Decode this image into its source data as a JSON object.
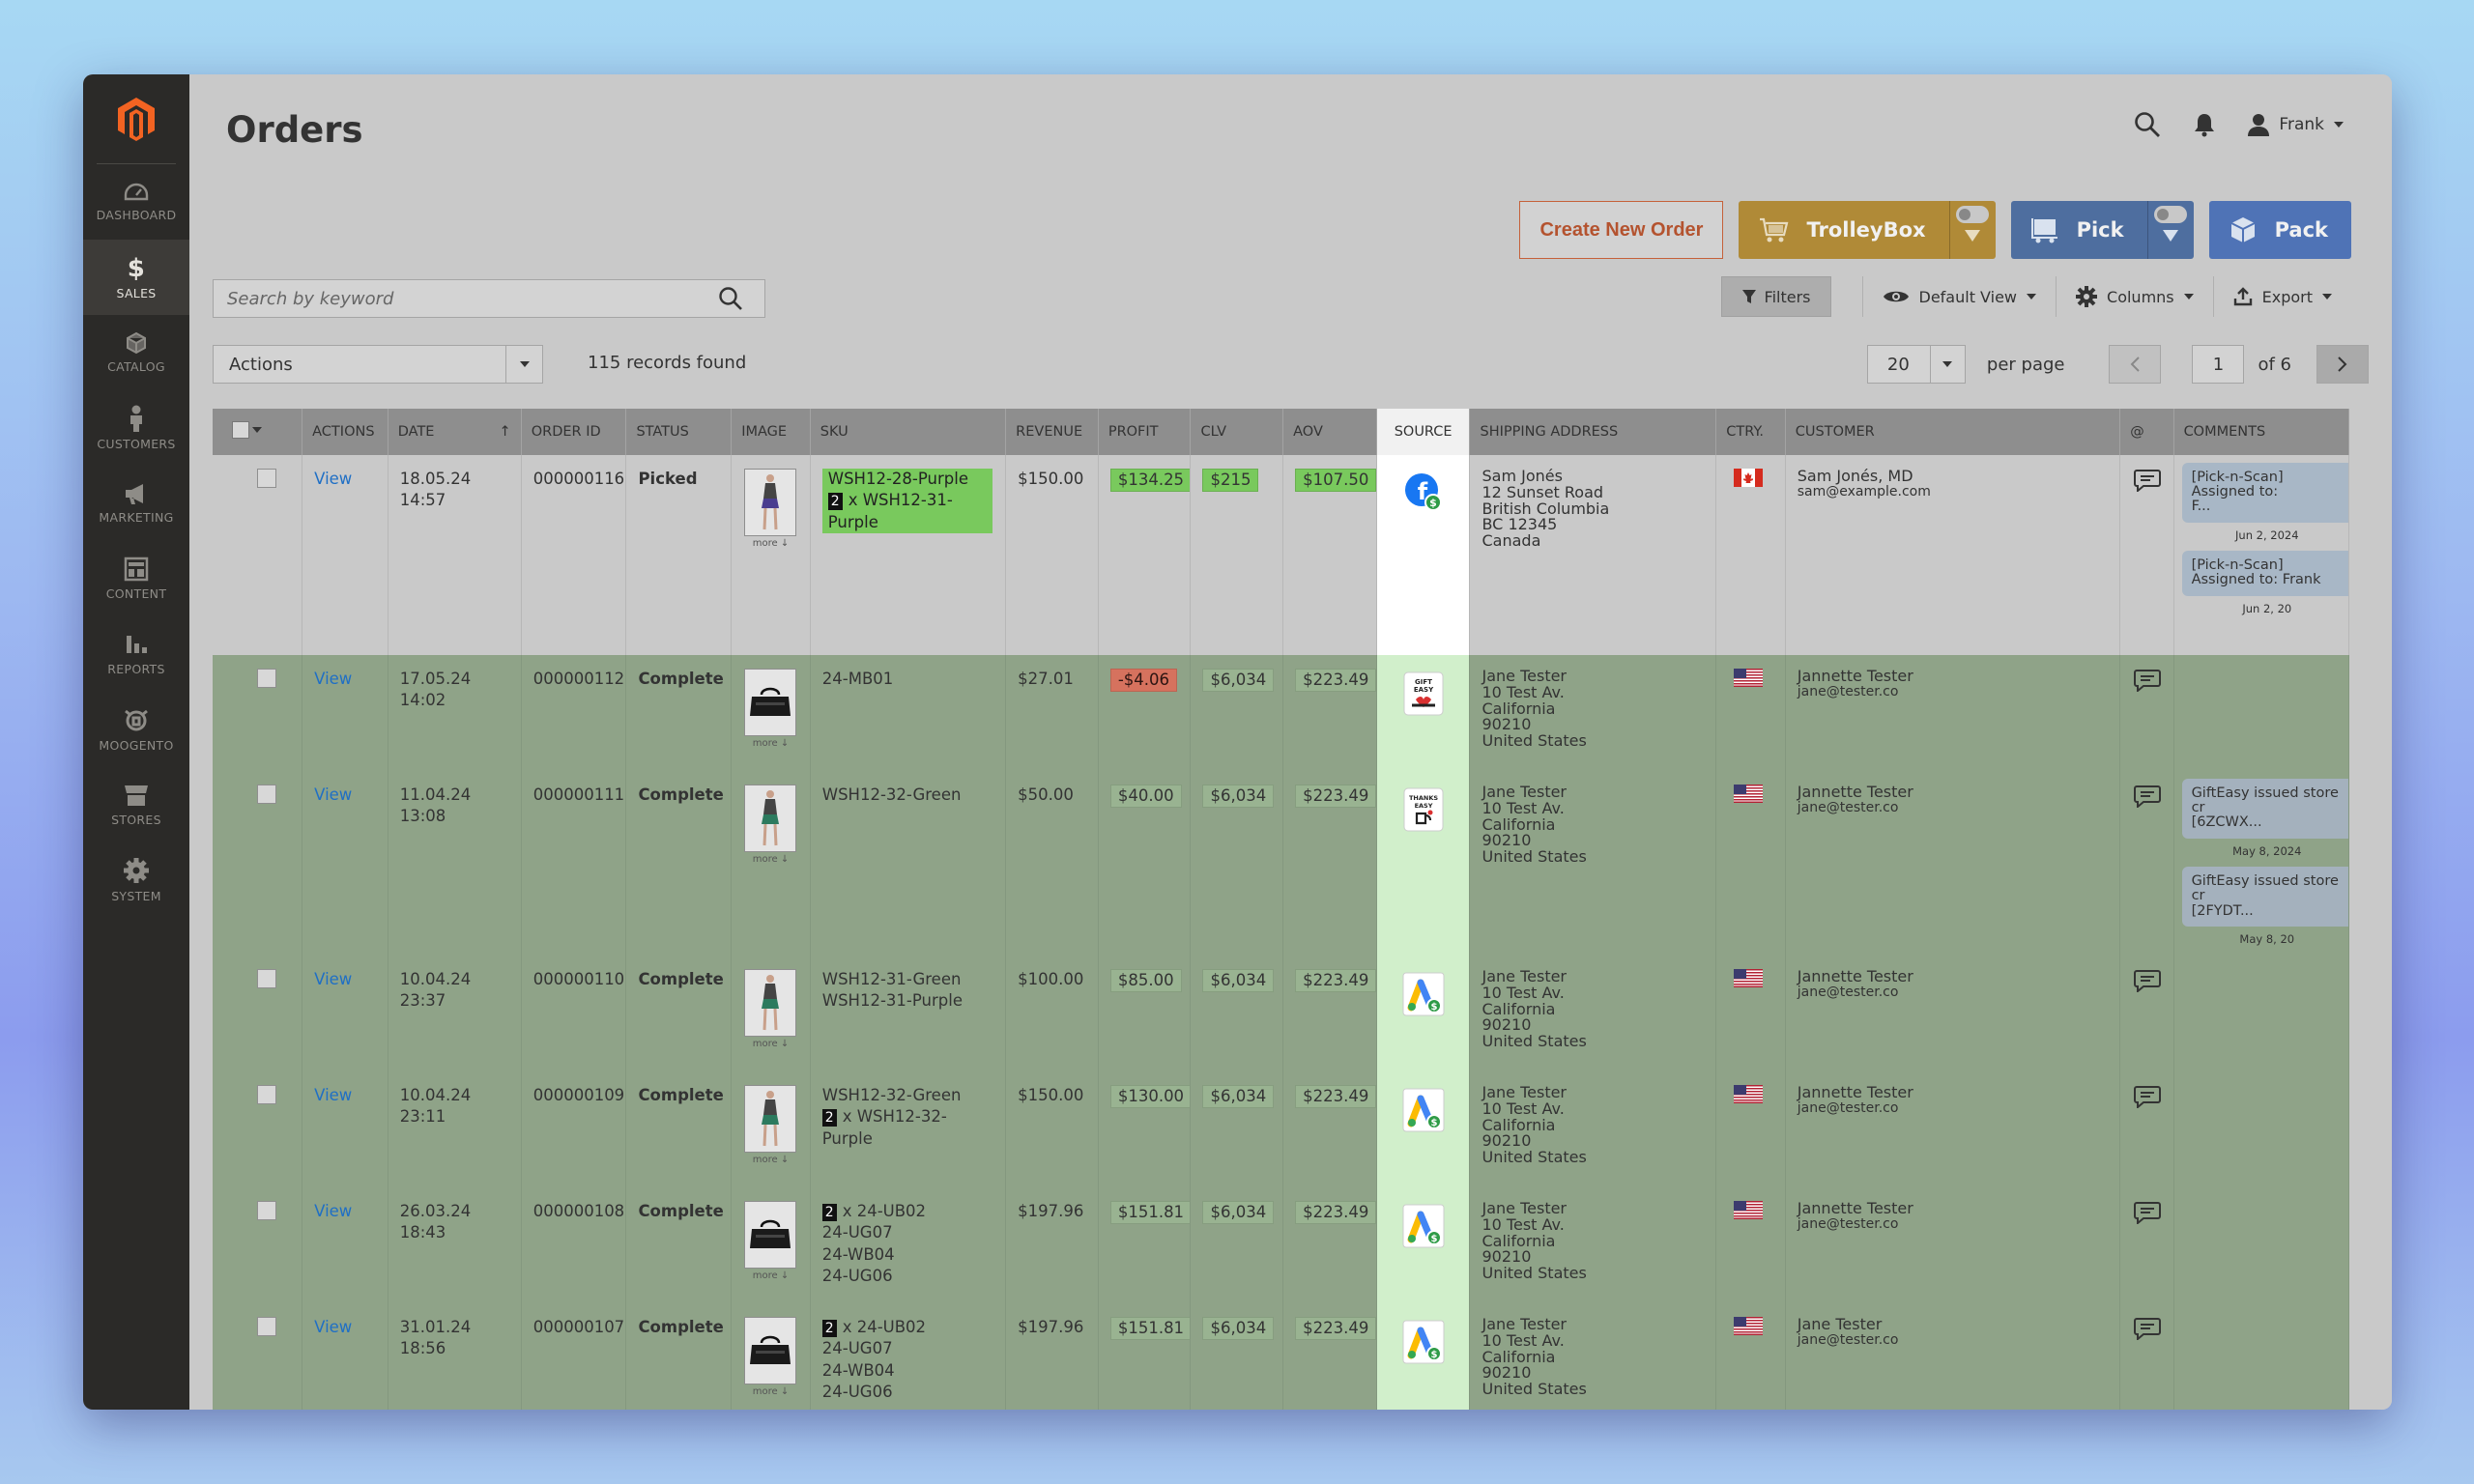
{
  "sidebar": {
    "items": [
      {
        "label": "DASHBOARD",
        "icon": "dashboard-icon"
      },
      {
        "label": "SALES",
        "icon": "dollar-icon"
      },
      {
        "label": "CATALOG",
        "icon": "cube-icon"
      },
      {
        "label": "CUSTOMERS",
        "icon": "person-icon"
      },
      {
        "label": "MARKETING",
        "icon": "megaphone-icon"
      },
      {
        "label": "CONTENT",
        "icon": "layout-icon"
      },
      {
        "label": "REPORTS",
        "icon": "bar-chart-icon"
      },
      {
        "label": "MOOGENTO",
        "icon": "moogento-icon"
      },
      {
        "label": "STORES",
        "icon": "store-icon"
      },
      {
        "label": "SYSTEM",
        "icon": "gear-icon"
      }
    ]
  },
  "header": {
    "title": "Orders",
    "user": "Frank",
    "create_order": "Create New Order",
    "trolleybox": "TrolleyBox",
    "pick": "Pick",
    "pack": "Pack"
  },
  "search": {
    "placeholder": "Search by keyword"
  },
  "toolbar": {
    "filters": "Filters",
    "view": "Default View",
    "columns": "Columns",
    "export": "Export",
    "actions": "Actions",
    "records": "115 records found",
    "per_page_value": "20",
    "per_page_label": "per page",
    "page": "1",
    "of_pages": "of 6"
  },
  "columns": [
    "ACTIONS",
    "DATE",
    "ORDER ID",
    "STATUS",
    "IMAGE",
    "SKU",
    "REVENUE",
    "PROFIT",
    "CLV",
    "AOV",
    "SOURCE",
    "SHIPPING ADDRESS",
    "CTRY.",
    "CUSTOMER",
    "@",
    "COMMENTS"
  ],
  "sort_indicator": "↑",
  "more_label": "more ↓",
  "rows": [
    {
      "action": "View",
      "date": "18.05.24 14:57",
      "order_id": "000000116",
      "status": "Picked",
      "sku1": "WSH12-28-Purple",
      "sku2_qty": "2",
      "sku2": "x WSH12-31-Purple",
      "revenue": "$150.00",
      "profit": "$134.25",
      "clv": "$215",
      "aov": "$107.50",
      "source": "facebook-icon",
      "addr": [
        "Sam Jonés",
        "12 Sunset Road",
        "British Columbia",
        "BC 12345",
        "Canada"
      ],
      "country": "CA",
      "customer": "Sam Jonés, MD",
      "email": "sam@example.com",
      "comments": [
        {
          "text": "[Pick-n-Scan]\nAssigned to:\nF...",
          "date": "Jun 2, 2024"
        },
        {
          "text": "[Pick-n-Scan]\nAssigned to: Frank",
          "date": "Jun 2, 20"
        }
      ]
    },
    {
      "action": "View",
      "date": "17.05.24 14:02",
      "order_id": "000000112",
      "status": "Complete",
      "sku1": "24-MB01",
      "revenue": "$27.01",
      "profit": "-$4.06",
      "clv": "$6,034",
      "aov": "$223.49",
      "source": "gift-easy-icon",
      "addr": [
        "Jane Tester",
        "10 Test Av.",
        "California",
        "90210",
        "United States"
      ],
      "country": "US",
      "customer": "Jannette Tester",
      "email": "jane@tester.co",
      "comments": []
    },
    {
      "action": "View",
      "date": "11.04.24 13:08",
      "order_id": "000000111",
      "status": "Complete",
      "sku1": "WSH12-32-Green",
      "revenue": "$50.00",
      "profit": "$40.00",
      "clv": "$6,034",
      "aov": "$223.49",
      "source": "thanks-easy-icon",
      "addr": [
        "Jane Tester",
        "10 Test Av.",
        "California",
        "90210",
        "United States"
      ],
      "country": "US",
      "customer": "Jannette Tester",
      "email": "jane@tester.co",
      "comments": [
        {
          "text": "GiftEasy issued store cr\n[6ZCWX...",
          "date": "May 8, 2024"
        },
        {
          "text": "GiftEasy issued store cr\n[2FYDT...",
          "date": "May 8, 20"
        }
      ]
    },
    {
      "action": "View",
      "date": "10.04.24 23:37",
      "order_id": "000000110",
      "status": "Complete",
      "sku1": "WSH12-31-Green",
      "sku2": "WSH12-31-Purple",
      "revenue": "$100.00",
      "profit": "$85.00",
      "clv": "$6,034",
      "aov": "$223.49",
      "source": "google-ads-icon",
      "addr": [
        "Jane Tester",
        "10 Test Av.",
        "California",
        "90210",
        "United States"
      ],
      "country": "US",
      "customer": "Jannette Tester",
      "email": "jane@tester.co",
      "comments": []
    },
    {
      "action": "View",
      "date": "10.04.24 23:11",
      "order_id": "000000109",
      "status": "Complete",
      "sku1": "WSH12-32-Green",
      "sku2_qty": "2",
      "sku2": "x WSH12-32-Purple",
      "revenue": "$150.00",
      "profit": "$130.00",
      "clv": "$6,034",
      "aov": "$223.49",
      "source": "google-ads-icon",
      "addr": [
        "Jane Tester",
        "10 Test Av.",
        "California",
        "90210",
        "United States"
      ],
      "country": "US",
      "customer": "Jannette Tester",
      "email": "jane@tester.co",
      "comments": []
    },
    {
      "action": "View",
      "date": "26.03.24 18:43",
      "order_id": "000000108",
      "status": "Complete",
      "sku1_qty": "2",
      "sku1": "x 24-UB02",
      "sku_more": [
        "24-UG07",
        "24-WB04",
        "24-UG06"
      ],
      "revenue": "$197.96",
      "profit": "$151.81",
      "clv": "$6,034",
      "aov": "$223.49",
      "source": "google-ads-icon",
      "addr": [
        "Jane Tester",
        "10 Test Av.",
        "California",
        "90210",
        "United States"
      ],
      "country": "US",
      "customer": "Jannette Tester",
      "email": "jane@tester.co",
      "comments": []
    },
    {
      "action": "View",
      "date": "31.01.24 18:56",
      "order_id": "000000107",
      "status": "Complete",
      "sku1_qty": "2",
      "sku1": "x 24-UB02",
      "sku_more": [
        "24-UG07",
        "24-WB04",
        "24-UG06"
      ],
      "revenue": "$197.96",
      "profit": "$151.81",
      "clv": "$6,034",
      "aov": "$223.49",
      "source": "google-ads-icon",
      "addr": [
        "Jane Tester",
        "10 Test Av.",
        "California",
        "90210",
        "United States"
      ],
      "country": "US",
      "customer": "Jane Tester",
      "email": "jane@tester.co",
      "comments": []
    }
  ],
  "colors": {
    "sidebar": "#2b2a28",
    "accent": "#eb5202",
    "complete_row": "#8fa388",
    "trolleybox": "#b08a37",
    "pick": "#4e6e9f",
    "pack": "#4f73b6",
    "profit_positive": "#79c95d",
    "profit_negative": "#d6725e"
  }
}
